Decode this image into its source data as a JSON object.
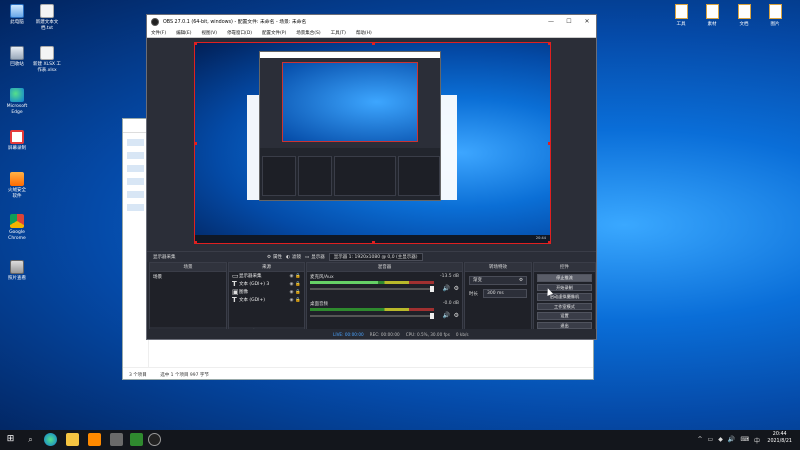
{
  "desktop_icons": [
    {
      "name": "desktop-icon-this-pc",
      "label": "此电脑"
    },
    {
      "name": "desktop-icon-new-text-doc",
      "label": "新建文本文\n档.txt"
    },
    {
      "name": "desktop-icon-recycle-bin",
      "label": "回收站"
    },
    {
      "name": "desktop-icon-new-xlsx",
      "label": "新建 XLSX 工\n作表.xlsx"
    },
    {
      "name": "desktop-icon-edge",
      "label": "Microsoft\nEdge"
    },
    {
      "name": "desktop-icon-red-app",
      "label": "屏幕录制"
    },
    {
      "name": "desktop-icon-orange-app",
      "label": "火绒安全\n软件"
    },
    {
      "name": "desktop-icon-chrome",
      "label": "Google\nChrome"
    },
    {
      "name": "desktop-icon-photo",
      "label": "照片查看"
    }
  ],
  "right_icons": [
    "工具",
    "素材",
    "文档",
    "图片"
  ],
  "explorer": {
    "status_items": "3 个项目",
    "status_selected": "选中 1 个项目  997 字节"
  },
  "obs": {
    "title": "OBS 27.0.1 (64-bit, windows) - 配置文件: 未命名 - 场景: 未命名",
    "menu": [
      "文件(F)",
      "编辑(E)",
      "视图(V)",
      "停靠窗口(D)",
      "配置文件(P)",
      "场景集合(S)",
      "工具(T)",
      "帮助(H)"
    ],
    "toolbar": {
      "scene_label": "显示器采集",
      "props": "属性",
      "filters": "滤镜",
      "display_label": "显示器",
      "display_value": "显示器 1: 1920x1080 @ 0,0 (主显示器)"
    },
    "scenes": {
      "header": "场景",
      "items": [
        "场景"
      ]
    },
    "sources": {
      "header": "来源",
      "items": [
        {
          "type": "monitor",
          "name": "显示器采集"
        },
        {
          "type": "text",
          "name": "文本 (GDI+) 3"
        },
        {
          "type": "image",
          "name": "图像"
        },
        {
          "type": "text",
          "name": "文本 (GDI+)"
        }
      ]
    },
    "mixer": {
      "header": "混音器",
      "channels": [
        {
          "name": "麦克风/Aux",
          "db": "-13.5 dB",
          "level": 0.55
        },
        {
          "name": "桌面音频",
          "db": "-0.0 dB",
          "level": 0.0
        }
      ]
    },
    "transitions": {
      "header": "转场特效",
      "type": "渐变",
      "duration_label": "时长",
      "duration": "300 ms"
    },
    "controls": {
      "header": "控件",
      "buttons": [
        "停止推流",
        "开始录制",
        "启动虚拟摄像机",
        "工作室模式",
        "设置",
        "退出"
      ]
    },
    "status": {
      "live": "LIVE:",
      "live_time": "00:00:00",
      "rec": "REC:",
      "rec_time": "00:00:00",
      "cpu": "CPU: 0.5%, 30.00 fps",
      "kbps": "0 kb/s"
    }
  },
  "taskbar": {
    "time": "20:44",
    "date": "2021/8/21"
  }
}
